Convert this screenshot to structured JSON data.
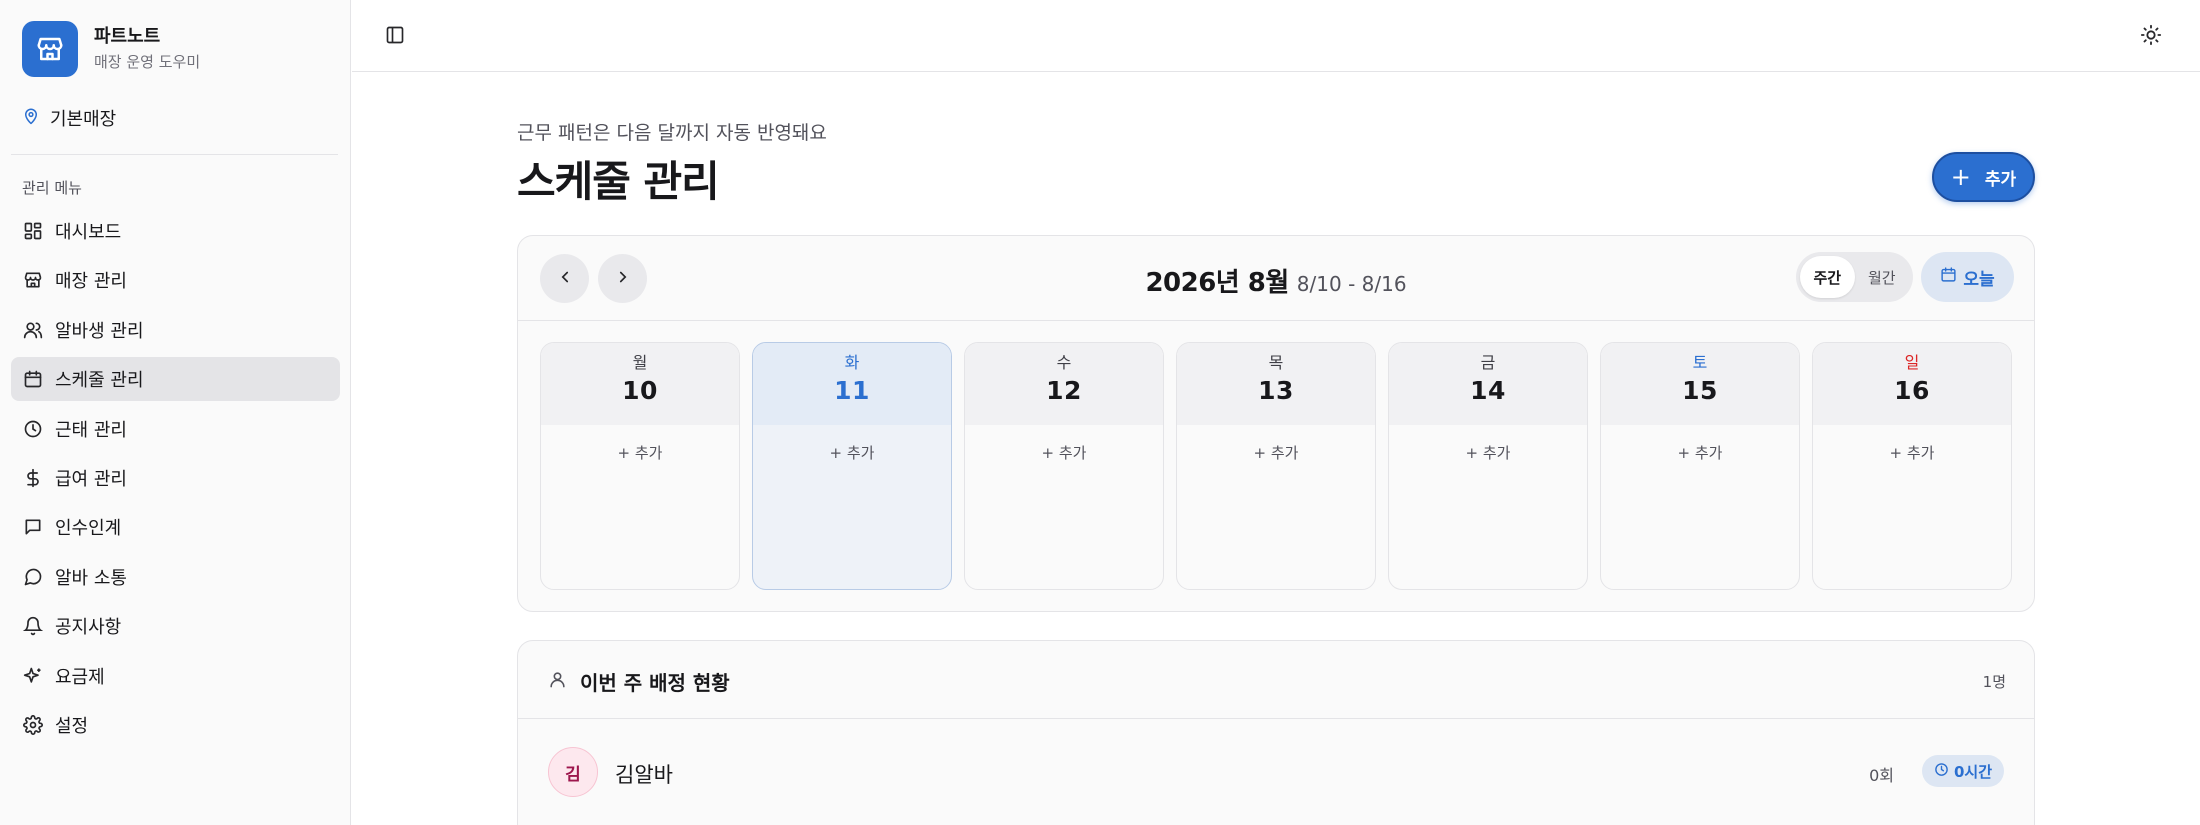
{
  "brand": {
    "name": "파트노트",
    "subtitle": "매장 운영 도우미",
    "icon": "store-icon",
    "color": "#2b6fd0"
  },
  "store": {
    "name": "기본매장",
    "icon": "map-pin-icon"
  },
  "sidebar": {
    "section_label": "관리 메뉴",
    "items": [
      {
        "label": "대시보드",
        "icon": "dashboard-icon",
        "active": false
      },
      {
        "label": "매장 관리",
        "icon": "store-icon",
        "active": false
      },
      {
        "label": "알바생 관리",
        "icon": "users-icon",
        "active": false
      },
      {
        "label": "스케줄 관리",
        "icon": "calendar-icon",
        "active": true
      },
      {
        "label": "근태 관리",
        "icon": "clock-icon",
        "active": false
      },
      {
        "label": "급여 관리",
        "icon": "dollar-icon",
        "active": false
      },
      {
        "label": "인수인계",
        "icon": "message-square-icon",
        "active": false
      },
      {
        "label": "알바 소통",
        "icon": "message-circle-icon",
        "active": false
      },
      {
        "label": "공지사항",
        "icon": "bell-icon",
        "active": false
      },
      {
        "label": "요금제",
        "icon": "sparkles-icon",
        "active": false
      },
      {
        "label": "설정",
        "icon": "gear-icon",
        "active": false
      }
    ]
  },
  "topbar": {
    "toggle_icon": "sidebar-toggle-icon",
    "theme_icon": "sun-icon"
  },
  "page": {
    "subtitle": "근무 패턴은 다음 달까지 자동 반영돼요",
    "title": "스케줄 관리",
    "add_label": "추가"
  },
  "calendar": {
    "month_label": "2026년 8월",
    "range": "8/10 - 8/16",
    "view_options": [
      "주간",
      "월간"
    ],
    "active_view": "주간",
    "today_label": "오늘",
    "day_add_label": "+ 추가",
    "days": [
      {
        "weekday": "월",
        "date": "10"
      },
      {
        "weekday": "화",
        "date": "11",
        "selected": true
      },
      {
        "weekday": "수",
        "date": "12"
      },
      {
        "weekday": "목",
        "date": "13"
      },
      {
        "weekday": "금",
        "date": "14"
      },
      {
        "weekday": "토",
        "date": "15"
      },
      {
        "weekday": "일",
        "date": "16"
      }
    ]
  },
  "assignments": {
    "title": "이번 주 배정 현황",
    "count": "1명",
    "rows": [
      {
        "initial": "김",
        "name": "김알바",
        "shifts": "0회",
        "hours": "0시간"
      }
    ]
  },
  "colors": {
    "accent": "#2b6fd0",
    "saturday": "#2b6fd0",
    "sunday": "#dc2626"
  }
}
